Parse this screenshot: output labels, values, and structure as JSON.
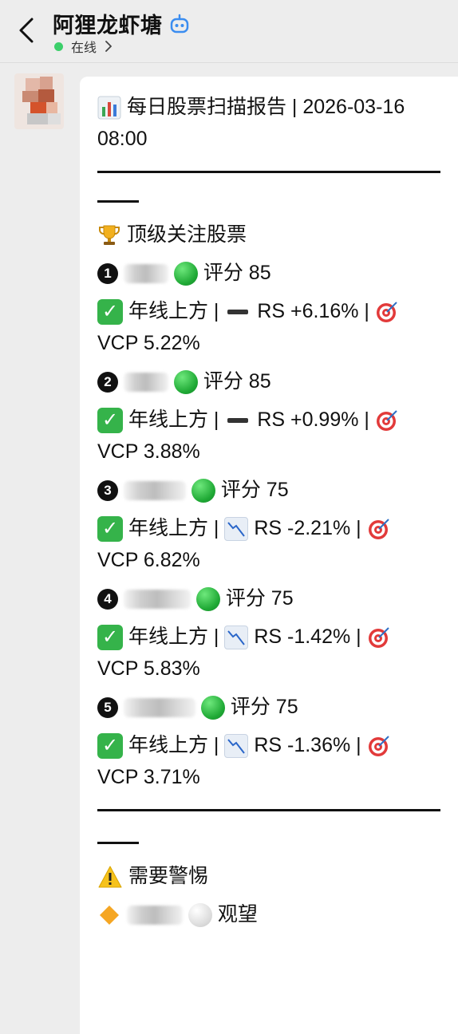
{
  "header": {
    "title": "阿狸龙虾塘",
    "status": "在线"
  },
  "message": {
    "title_line1": "每日股票扫描报告 | 2026-03-16",
    "title_line2": "08:00",
    "section_top": "顶级关注股票",
    "stocks": [
      {
        "num": "1",
        "score": "评分 85",
        "trend_text": "年线上方 |",
        "rs": "RS +6.16% |",
        "vcp": "VCP 5.22%",
        "trend_icon": "flat-dash-icon"
      },
      {
        "num": "2",
        "score": "评分 85",
        "trend_text": "年线上方 |",
        "rs": "RS +0.99% |",
        "vcp": "VCP 3.88%",
        "trend_icon": "flat-dash-icon"
      },
      {
        "num": "3",
        "score": "评分 75",
        "trend_text": "年线上方 |",
        "rs": "RS -2.21% |",
        "vcp": "VCP 6.82%",
        "trend_icon": "chart-decreasing-icon"
      },
      {
        "num": "4",
        "score": "评分 75",
        "trend_text": "年线上方 |",
        "rs": "RS -1.42% |",
        "vcp": "VCP 5.83%",
        "trend_icon": "chart-decreasing-icon"
      },
      {
        "num": "5",
        "score": "评分 75",
        "trend_text": "年线上方 |",
        "rs": "RS -1.36% |",
        "vcp": "VCP 3.71%",
        "trend_icon": "chart-decreasing-icon"
      }
    ],
    "section_alert": "需要警惕",
    "alert_item": "观望"
  },
  "colors": {
    "background": "#ededed",
    "bubble": "#ffffff",
    "online": "#3ccf6a",
    "green_circle": "#1fa935",
    "check": "#35b34a"
  }
}
